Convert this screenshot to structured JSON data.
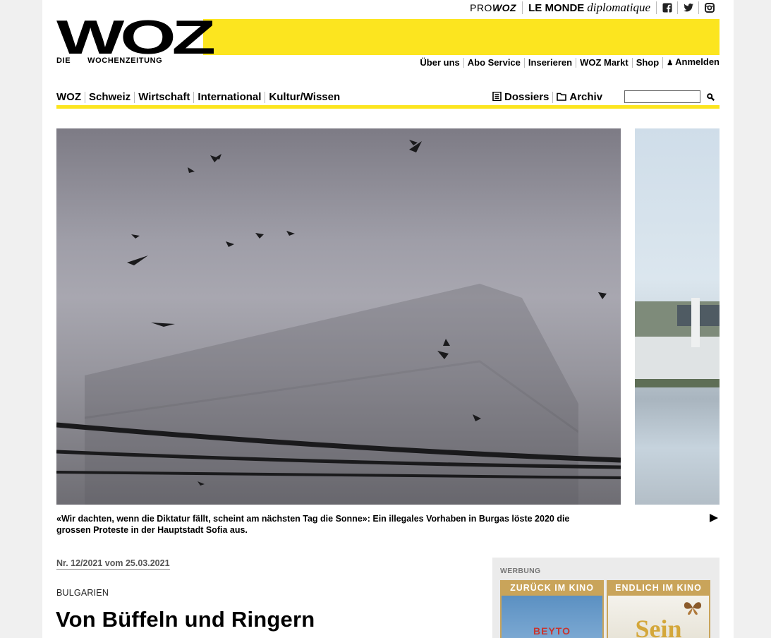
{
  "partners": {
    "prowoz_pre": "PRO",
    "prowoz_brand": "WOZ",
    "lmd_main": "LE MONDE",
    "lmd_sub": "diplomatique"
  },
  "logo": {
    "letters": "WOZ",
    "sub_die": "DIE",
    "sub_name": "WOCHENZEITUNG"
  },
  "service_nav": [
    "Über uns",
    "Abo Service",
    "Inserieren",
    "WOZ Markt",
    "Shop",
    "Anmelden"
  ],
  "main_nav": [
    "WOZ",
    "Schweiz",
    "Wirtschaft",
    "International",
    "Kultur/Wissen"
  ],
  "secondary_nav": {
    "dossiers": "Dossiers",
    "archiv": "Archiv"
  },
  "search": {
    "value": "",
    "placeholder": ""
  },
  "colors": {
    "accent": "#fce51f",
    "ad_gold": "#c9a45a"
  },
  "hero": {
    "caption": "«Wir dachten, wenn die Diktatur fällt, scheint am nächsten Tag die Sonne»: Ein illegales Vorhaben in Burgas löste 2020 die grossen Proteste in der Hauptstadt Sofia aus."
  },
  "article": {
    "issue": "Nr. 12/2021 vom 25.03.2021",
    "kicker": "BULGARIEN",
    "headline": "Von Büffeln und Ringern"
  },
  "ad": {
    "label": "WERBUNG",
    "card1_banner": "ZURÜCK IM KINO",
    "card1_title": "BEYTO",
    "card2_banner": "ENDLICH IM KINO",
    "card2_title": "Sein"
  }
}
